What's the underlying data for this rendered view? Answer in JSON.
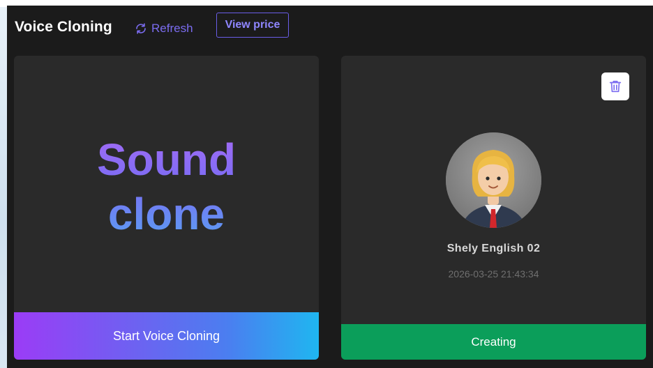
{
  "header": {
    "title": "Voice Cloning",
    "refresh_label": "Refresh",
    "view_price_label": "View price"
  },
  "clone_card": {
    "line1": "Sound",
    "line2": "clone",
    "start_label": "Start Voice Cloning"
  },
  "voice_card": {
    "name": "Shely English 02",
    "created_at": "2026-03-25 21:43:34",
    "status_label": "Creating",
    "delete_icon": "trash-icon"
  },
  "colors": {
    "panel_bg": "#1b1b1b",
    "card_bg": "#2a2a2a",
    "accent": "#7b6cf0",
    "status_green": "#0b9e5a"
  }
}
